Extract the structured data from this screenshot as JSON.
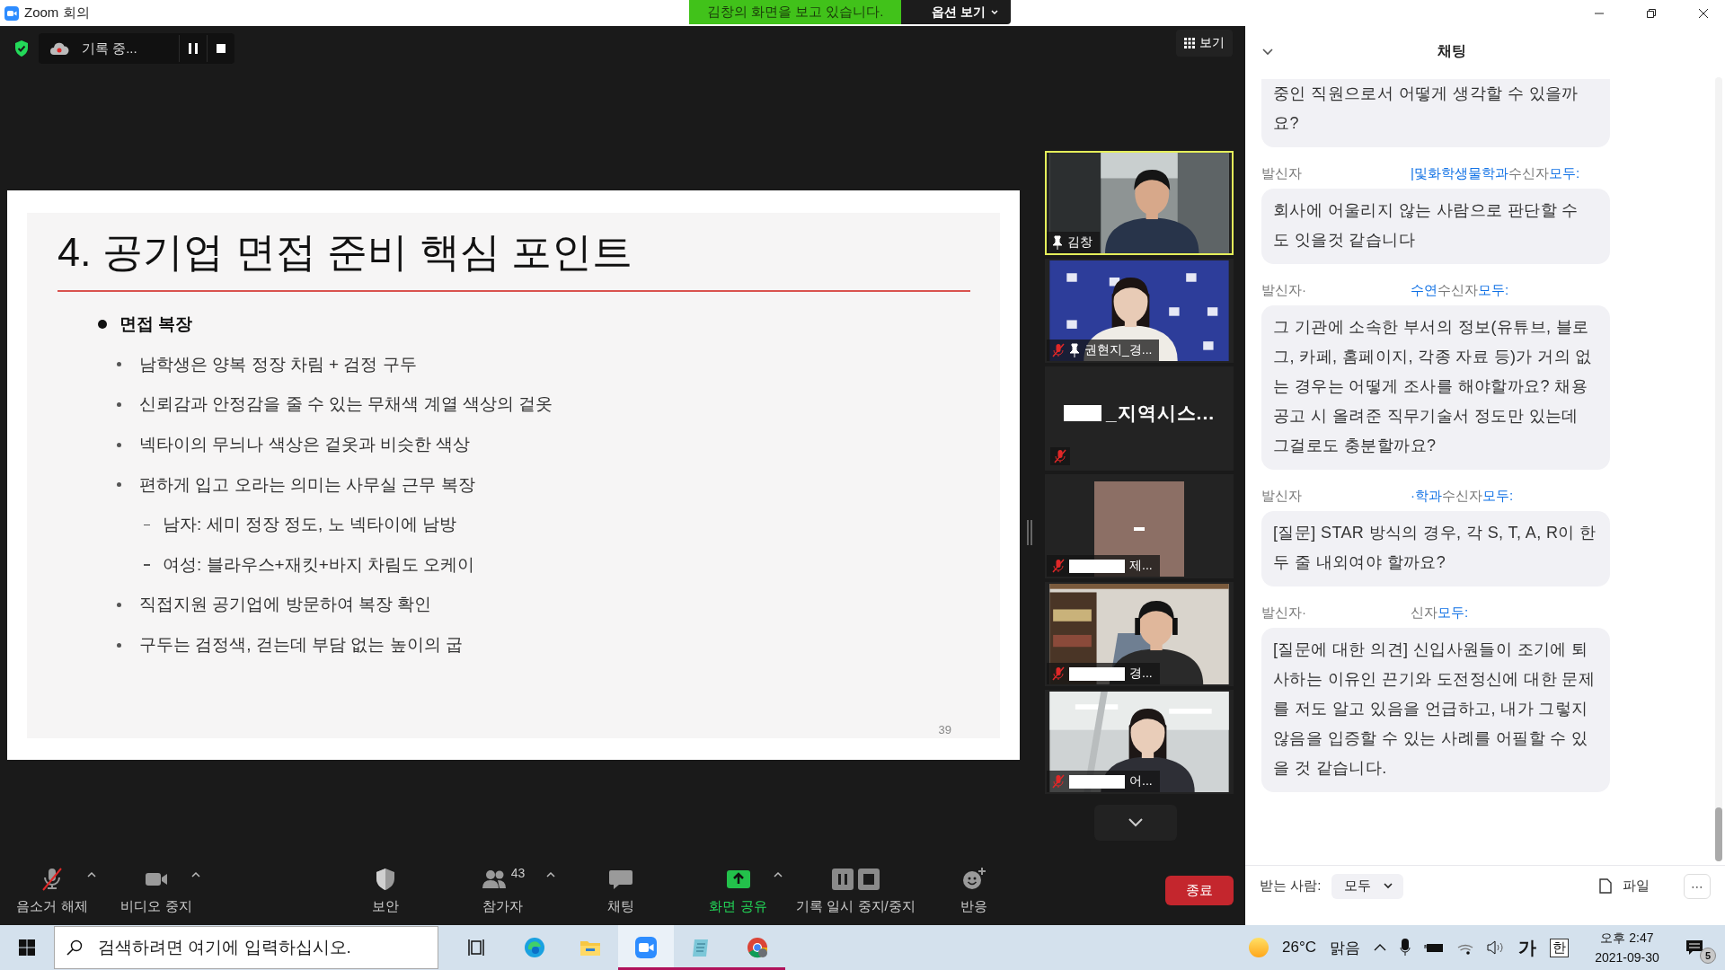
{
  "window": {
    "title": "Zoom 회의"
  },
  "share_banner": {
    "text": "김창의 화면을 보고 있습니다.",
    "options": "옵션 보기"
  },
  "recording": {
    "label": "기록 중..."
  },
  "view_button": {
    "label": "보기"
  },
  "slide": {
    "title": "4. 공기업 면접 준비 핵심 포인트",
    "page": "39",
    "bullets": [
      {
        "text": "면접 복장",
        "children": [
          {
            "text": "남학생은 양복 정장 차림 + 검정 구두"
          },
          {
            "text": "신뢰감과 안정감을 줄 수 있는 무채색 계열 색상의 겉옷"
          },
          {
            "text": "넥타이의 무늬나 색상은 겉옷과 비슷한 색상"
          },
          {
            "text": "편하게 입고 오라는 의미는 사무실 근무 복장",
            "children": [
              {
                "text": "남자: 세미 정장 정도, 노 넥타이에  남방"
              },
              {
                "text": "여성: 블라우스+재킷+바지 차림도 오케이"
              }
            ]
          },
          {
            "text": "직접지원 공기업에 방문하여 복장 확인"
          },
          {
            "text": "구두는 검정색, 걷는데 부담 없는 높이의 굽"
          }
        ]
      }
    ]
  },
  "participants": [
    {
      "kind": "picture",
      "name": "김창",
      "pinned": true,
      "muted": false,
      "active": true,
      "redacted": false
    },
    {
      "kind": "picture",
      "name": "권현지_경...",
      "pinned": true,
      "muted": true,
      "active": false,
      "redacted": false
    },
    {
      "kind": "name",
      "name": "_지역시스...",
      "pinned": false,
      "muted": true,
      "active": false,
      "redacted": true
    },
    {
      "kind": "avatar",
      "name": "제...",
      "pinned": false,
      "muted": true,
      "active": false,
      "redacted": true
    },
    {
      "kind": "picture",
      "name": "경...",
      "pinned": false,
      "muted": true,
      "active": false,
      "redacted": true
    },
    {
      "kind": "picture",
      "name": "어...",
      "pinned": false,
      "muted": true,
      "active": false,
      "redacted": true
    }
  ],
  "chat": {
    "title": "채팅",
    "messages": [
      {
        "cut_top": true,
        "text": "중인 직원으로서 어떻게 생각할 수 있을까요?"
      },
      {
        "from_label": "발신자",
        "sender": "|및화학생물학과",
        "to_label": "수신자",
        "to": "모두:",
        "text": "회사에 어울리지 않는 사람으로 판단할 수 도 잇을것 같습니다"
      },
      {
        "from_label": "발신자·",
        "sender": "수연",
        "to_label": "수신자",
        "to": "모두:",
        "text": "그 기관에 소속한 부서의 정보(유튜브, 블로그, 카페, 홈페이지, 각종 자료 등)가 거의 없는 경우는 어떻게 조사를 해야할까요? 채용공고 시 올려준 직무기술서 정도만 있는데 그걸로도 충분할까요?"
      },
      {
        "from_label": "발신자",
        "sender": "·학과",
        "to_label": "수신자",
        "to": "모두:",
        "text": "[질문] STAR 방식의 경우, 각 S, T, A, R이 한두 줄 내외여야 할까요?"
      },
      {
        "from_label": "발신자·",
        "to_label": "신자",
        "to": "모두:",
        "text": "[질문에 대한 의견] 신입사원들이 조기에 퇴사하는 이유인 끈기와 도전정신에 대한 문제를 저도 알고 있음을 언급하고, 내가 그렇지 않음을 입증할 수 있는 사례를 어필할 수 있을 것 같습니다."
      }
    ],
    "footer": {
      "to_label": "받는 사람:",
      "to": "모두",
      "file": "파일",
      "more": "⋯"
    }
  },
  "toolbar": [
    {
      "kind": "audio",
      "label": "음소거 해제",
      "muted": true,
      "caret": true
    },
    {
      "kind": "video",
      "label": "비디오 중지",
      "caret": true
    },
    {
      "kind": "security",
      "label": "보안",
      "caret": false
    },
    {
      "kind": "participants",
      "label": "참가자",
      "count": "43",
      "caret": true
    },
    {
      "kind": "chat",
      "label": "채팅",
      "caret": false
    },
    {
      "kind": "share",
      "label": "화면 공유",
      "caret": true
    },
    {
      "kind": "record",
      "label": "기록 일시 중지/중지",
      "caret": false
    },
    {
      "kind": "reactions",
      "label": "반응",
      "caret": false
    }
  ],
  "end_button": {
    "label": "종료"
  },
  "taskbar": {
    "search": {
      "placeholder": "검색하려면 여기에 입력하십시오."
    },
    "apps": [
      {
        "kind": "taskview",
        "running": false,
        "active": false
      },
      {
        "kind": "edge",
        "running": false,
        "active": false
      },
      {
        "kind": "explorer",
        "running": false,
        "active": false
      },
      {
        "kind": "zoom",
        "running": true,
        "active": true
      },
      {
        "kind": "notepad",
        "running": true,
        "active": false
      },
      {
        "kind": "chrome",
        "running": true,
        "active": false
      }
    ],
    "weather": {
      "temp": "26°C",
      "text": "맑음"
    },
    "ime": "가",
    "ime_mode": "한",
    "time": "오후 2:47",
    "date": "2021-09-30",
    "notifications": "5"
  }
}
